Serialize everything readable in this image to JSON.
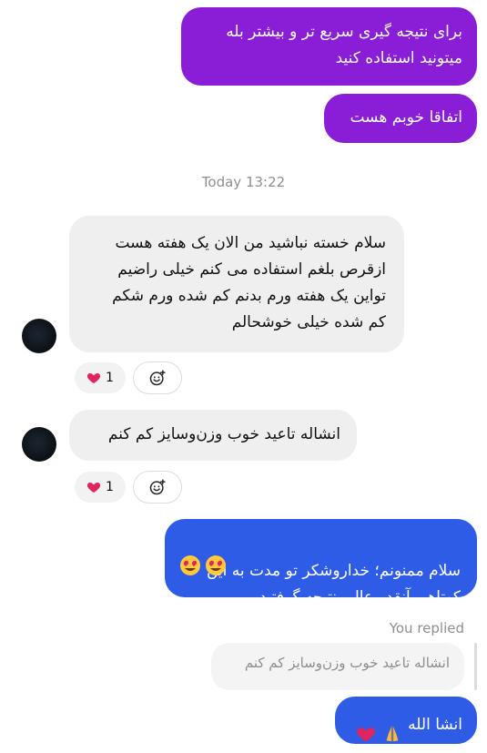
{
  "messages": {
    "m1": "برای نتیجه گیری سریع تر و بیشتر بله\nمیتونید استفاده کنید",
    "m2": "اتفاقا خوبم هست",
    "m3": "سلام خسته نباشید من الان یک هفته هست\nازقرص  بلغم استفاده می کنم خیلی راضیم\nتواین یک هفته ورم بدنم کم شده ورم شکم\nکم شده خیلی خوشحالم",
    "m4": "انشاله تاعید خوب وزن‌وسایز کم کنم",
    "m5": "سلام ممنونم؛ خداروشکر تو مدت به این\nکوتاهی آنقدر عالی نتیجه گرفتید",
    "m7": "انشا الله"
  },
  "timestamp": "Today 13:22",
  "reactions": {
    "r1_count": "1",
    "r2_count": "1"
  },
  "reply": {
    "label": "You replied",
    "quoted_text": "انشاله تاعید خوب وزن‌وسایز کم کنم"
  },
  "colors": {
    "outgoing_purple": "#8a1ed6",
    "outgoing_blue": "#2f5ce6",
    "incoming_gray": "#efefef",
    "heart_red": "#e0245e"
  },
  "icons": [
    "heart-icon",
    "add-reaction-icon",
    "heart-eyes-emoji",
    "praying-hands-emoji",
    "heart-emoji"
  ]
}
